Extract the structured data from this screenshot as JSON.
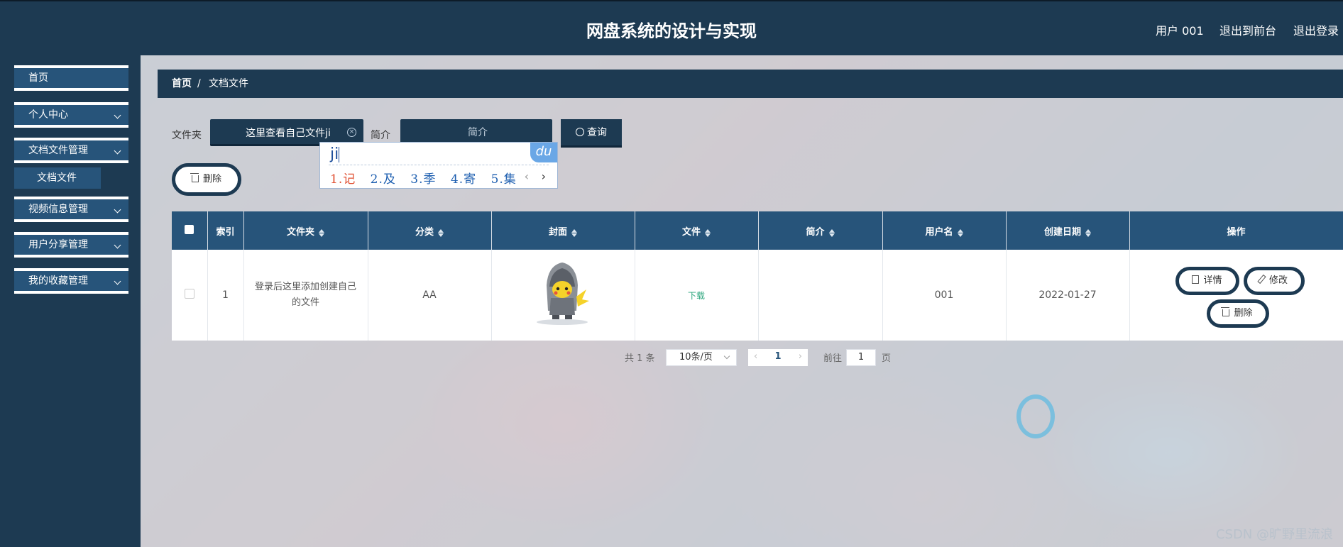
{
  "header": {
    "title": "网盘系统的设计与实现",
    "user": "用户 001",
    "back_front": "退出到前台",
    "logout": "退出登录"
  },
  "sidebar": {
    "items": [
      {
        "label": "首页"
      },
      {
        "label": "个人中心"
      },
      {
        "label": "文档文件管理"
      },
      {
        "label": "文档文件"
      },
      {
        "label": "视频信息管理"
      },
      {
        "label": "用户分享管理"
      },
      {
        "label": "我的收藏管理"
      }
    ]
  },
  "breadcrumb": {
    "home": "首页",
    "separator": "/",
    "current": "文档文件"
  },
  "search": {
    "folder_label": "文件夹",
    "folder_value": "这里查看自己文件ji",
    "intro_label": "简介",
    "intro_placeholder": "简介",
    "query_button": "查询"
  },
  "ime": {
    "composition": "ji",
    "candidates": [
      "1.记",
      "2.及",
      "3.季",
      "4.寄",
      "5.集"
    ],
    "prev": "‹",
    "next": "›",
    "logo": "du"
  },
  "toolbar": {
    "delete_button": "删除"
  },
  "table": {
    "headers": [
      "索引",
      "文件夹",
      "分类",
      "封面",
      "文件",
      "简介",
      "用户名",
      "创建日期",
      "操作"
    ],
    "rows": [
      {
        "index": "1",
        "folder": "登录后这里添加创建自己的文件",
        "category": "AA",
        "file": "下载",
        "intro": "",
        "username": "001",
        "created": "2022-01-27",
        "actions": {
          "detail": "详情",
          "edit": "修改",
          "delete": "删除"
        }
      }
    ]
  },
  "pagination": {
    "total": "共 1 条",
    "page_size": "10条/页",
    "current_page": "1",
    "goto_label": "前往",
    "goto_value": "1",
    "page_suffix": "页"
  },
  "watermark": "CSDN @旷野里流浪",
  "colors": {
    "navy": "#1d3a52",
    "accent": "#27547a",
    "download": "#2aa57c"
  }
}
